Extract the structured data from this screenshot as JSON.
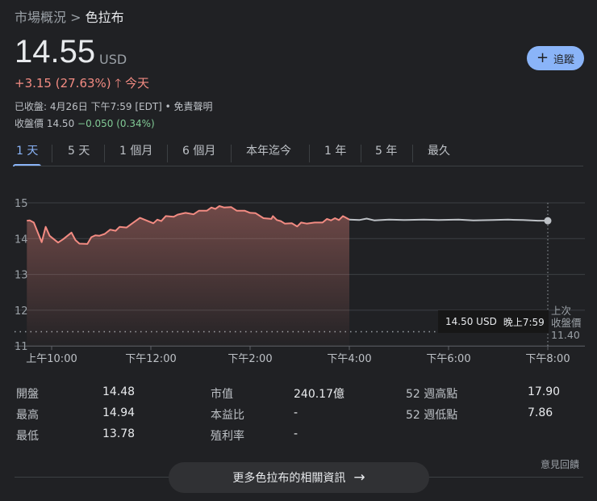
{
  "breadcrumb": {
    "parent": "市場概況",
    "separator": ">",
    "current": "色拉布"
  },
  "quote": {
    "price": "14.55",
    "currency": "USD",
    "change": "+3.15 (27.63%)",
    "change_arrow": "arrow-up-icon",
    "change_period": "今天",
    "closed_info": "已收盤: 4月26日 下午7:59 [EDT] • 免責聲明",
    "close_label": "收盤價",
    "close_price": "14.50",
    "after_change": "−0.050 (0.34%)"
  },
  "follow_button": {
    "label": "追蹤",
    "icon": "plus-icon"
  },
  "tabs": [
    "1 天",
    "5 天",
    "1 個月",
    "6 個月",
    "本年迄今",
    "1 年",
    "5 年",
    "最久"
  ],
  "active_tab": 0,
  "colors": {
    "up": "#f28b82",
    "down": "#81c995",
    "accent": "#8ab4f8",
    "after_hours": "#bdc1c6"
  },
  "chart_data": {
    "type": "line",
    "ylim": [
      11,
      15
    ],
    "yticks": [
      "15",
      "14",
      "13",
      "12",
      "11"
    ],
    "ytick_values": [
      15,
      14,
      13,
      12,
      11
    ],
    "xlim": [
      9.5,
      20
    ],
    "xticks": [
      "上午10:00",
      "下午12:00",
      "下午2:00",
      "下午4:00",
      "下午6:00",
      "下午8:00"
    ],
    "xtick_values": [
      10,
      12,
      14,
      16,
      18,
      20
    ],
    "previous_close": 11.4,
    "previous_close_label": [
      "上次",
      "收盤價"
    ],
    "previous_close_value": "11.40",
    "tooltip": {
      "price": "14.50 USD",
      "time": "晚上7:59"
    },
    "series": [
      {
        "name": "regular",
        "x": [
          9.5,
          9.56,
          9.64,
          9.8,
          9.88,
          9.96,
          10.13,
          10.23,
          10.4,
          10.48,
          10.56,
          10.72,
          10.8,
          10.88,
          10.96,
          11.07,
          11.18,
          11.29,
          11.37,
          11.51,
          11.62,
          11.78,
          12.05,
          12.13,
          12.21,
          12.3,
          12.46,
          12.54,
          12.7,
          12.86,
          12.97,
          13.13,
          13.22,
          13.3,
          13.38,
          13.48,
          13.62,
          13.73,
          13.89,
          14.0,
          14.11,
          14.27,
          14.43,
          14.46,
          14.54,
          14.62,
          14.7,
          14.84,
          14.95,
          15.03,
          15.14,
          15.3,
          15.46,
          15.55,
          15.63,
          15.71,
          15.79,
          15.87,
          15.95,
          16.0
        ],
        "y": [
          14.5,
          14.51,
          14.45,
          13.9,
          14.33,
          14.08,
          13.89,
          13.98,
          14.17,
          13.96,
          13.86,
          13.85,
          14.04,
          14.09,
          14.08,
          14.13,
          14.25,
          14.22,
          14.33,
          14.31,
          14.42,
          14.58,
          14.43,
          14.53,
          14.49,
          14.63,
          14.61,
          14.67,
          14.72,
          14.68,
          14.78,
          14.78,
          14.87,
          14.83,
          14.91,
          14.87,
          14.88,
          14.78,
          14.78,
          14.72,
          14.71,
          14.57,
          14.55,
          14.63,
          14.52,
          14.49,
          14.42,
          14.43,
          14.34,
          14.45,
          14.42,
          14.45,
          14.45,
          14.55,
          14.51,
          14.57,
          14.52,
          14.63,
          14.57,
          14.53
        ]
      },
      {
        "name": "after_hours",
        "x": [
          16.0,
          16.2,
          16.35,
          16.5,
          16.8,
          17.1,
          17.5,
          17.8,
          18.2,
          18.5,
          18.9,
          19.2,
          19.5,
          19.8,
          20.0
        ],
        "y": [
          14.53,
          14.52,
          14.56,
          14.51,
          14.53,
          14.52,
          14.53,
          14.52,
          14.53,
          14.51,
          14.52,
          14.53,
          14.52,
          14.5,
          14.5
        ]
      }
    ]
  },
  "stats": [
    {
      "label": "開盤",
      "value": "14.48"
    },
    {
      "label": "最高",
      "value": "14.94"
    },
    {
      "label": "最低",
      "value": "13.78"
    },
    {
      "label": "市值",
      "value": "240.17億"
    },
    {
      "label": "本益比",
      "value": "-"
    },
    {
      "label": "殖利率",
      "value": "-"
    },
    {
      "label": "52 週高點",
      "value": "17.90"
    },
    {
      "label": "52 週低點",
      "value": "7.86"
    }
  ],
  "feedback": "意見回饋",
  "more_button": {
    "label": "更多色拉布的相關資訊",
    "icon": "arrow-right-icon"
  }
}
